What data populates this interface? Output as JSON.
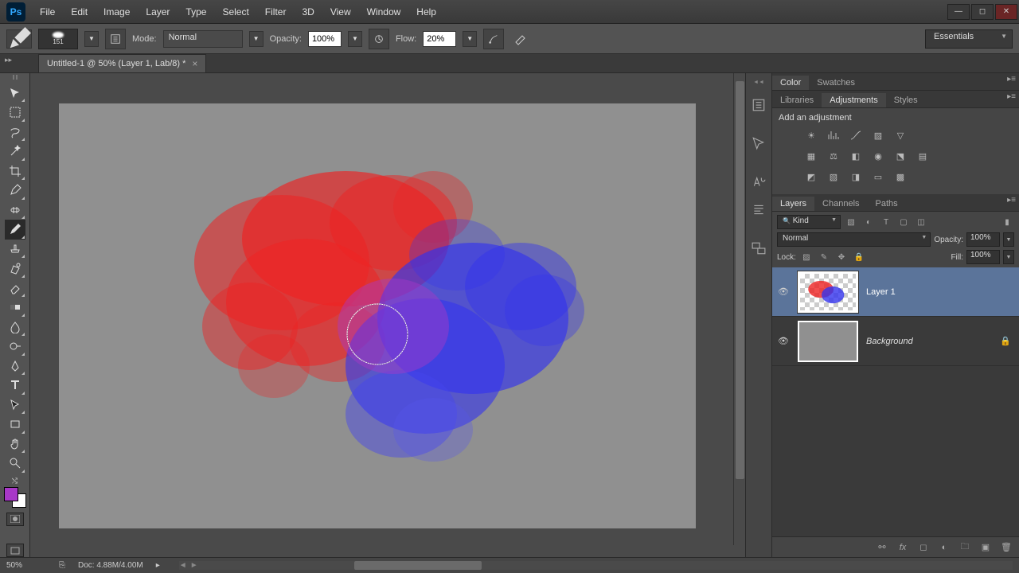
{
  "app": {
    "icon_text": "Ps"
  },
  "menu": [
    "File",
    "Edit",
    "Image",
    "Layer",
    "Type",
    "Select",
    "Filter",
    "3D",
    "View",
    "Window",
    "Help"
  ],
  "options": {
    "brush_size": "151",
    "mode_label": "Mode:",
    "mode_value": "Normal",
    "opacity_label": "Opacity:",
    "opacity_value": "100%",
    "flow_label": "Flow:",
    "flow_value": "20%",
    "workspace": "Essentials"
  },
  "doc_tab": "Untitled-1 @ 50% (Layer 1, Lab/8) *",
  "panels": {
    "color_tabs": [
      "Color",
      "Swatches"
    ],
    "adjustments_tabs": [
      "Libraries",
      "Adjustments",
      "Styles"
    ],
    "adjustments_title": "Add an adjustment",
    "layers_tabs": [
      "Layers",
      "Channels",
      "Paths"
    ],
    "layers": {
      "filter_kind": "Kind",
      "blend_mode": "Normal",
      "opacity_label": "Opacity:",
      "opacity_value": "100%",
      "lock_label": "Lock:",
      "fill_label": "Fill:",
      "fill_value": "100%",
      "items": [
        {
          "name": "Layer 1",
          "selected": true,
          "locked": false
        },
        {
          "name": "Background",
          "selected": false,
          "locked": true
        }
      ]
    }
  },
  "status": {
    "zoom": "50%",
    "doc_info": "Doc: 4.88M/4.00M"
  },
  "colors": {
    "foreground": "#a838c8",
    "accent": "#5b749a"
  }
}
